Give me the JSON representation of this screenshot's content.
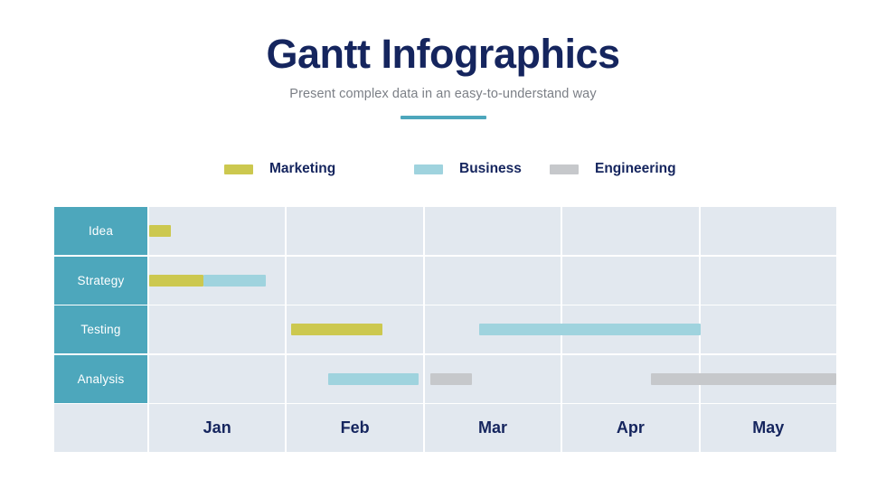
{
  "header": {
    "title": "Gantt Infographics",
    "subtitle": "Present complex data in an easy-to-understand way",
    "accent_color": "#4da7bc"
  },
  "legend": {
    "items": [
      {
        "label": "Marketing",
        "color": "#ccc84f"
      },
      {
        "label": "Business",
        "color": "#9fd3de"
      },
      {
        "label": "Engineering",
        "color": "#c6c8cb"
      }
    ]
  },
  "chart_data": {
    "type": "bar",
    "title": "Gantt Infographics",
    "subtitle": "Present complex data in an easy-to-understand way",
    "chart_kind": "gantt",
    "xlabel": "",
    "ylabel": "",
    "categories": [
      "Jan",
      "Feb",
      "Mar",
      "Apr",
      "May"
    ],
    "rows": [
      "Idea",
      "Strategy",
      "Testing",
      "Analysis"
    ],
    "series": [
      {
        "name": "Marketing",
        "color": "#ccc84f"
      },
      {
        "name": "Business",
        "color": "#9fd3de"
      },
      {
        "name": "Engineering",
        "color": "#c6c8cb"
      }
    ],
    "tasks": [
      {
        "row": "Idea",
        "series": "Marketing",
        "start_month": 1.0,
        "end_month": 1.16
      },
      {
        "row": "Strategy",
        "series": "Marketing",
        "start_month": 1.0,
        "end_month": 1.4
      },
      {
        "row": "Strategy",
        "series": "Business",
        "start_month": 1.4,
        "end_month": 1.86
      },
      {
        "row": "Testing",
        "series": "Marketing",
        "start_month": 2.03,
        "end_month": 2.7
      },
      {
        "row": "Testing",
        "series": "Business",
        "start_month": 3.4,
        "end_month": 5.0
      },
      {
        "row": "Analysis",
        "series": "Business",
        "start_month": 2.3,
        "end_month": 2.97
      },
      {
        "row": "Analysis",
        "series": "Engineering",
        "start_month": 3.04,
        "end_month": 3.35
      },
      {
        "row": "Analysis",
        "series": "Engineering",
        "start_month": 4.65,
        "end_month": 6.0
      }
    ],
    "axis_row_label": "",
    "grid": true,
    "legend_position": "top"
  },
  "grid_style": {
    "cell_background": "#e2e8ef",
    "label_background": "#4da7bc",
    "label_text_color": "#ffffff",
    "month_text_color": "#15255e"
  },
  "month_row": {
    "label": "",
    "months": [
      "Jan",
      "Feb",
      "Mar",
      "Apr",
      "May"
    ]
  }
}
